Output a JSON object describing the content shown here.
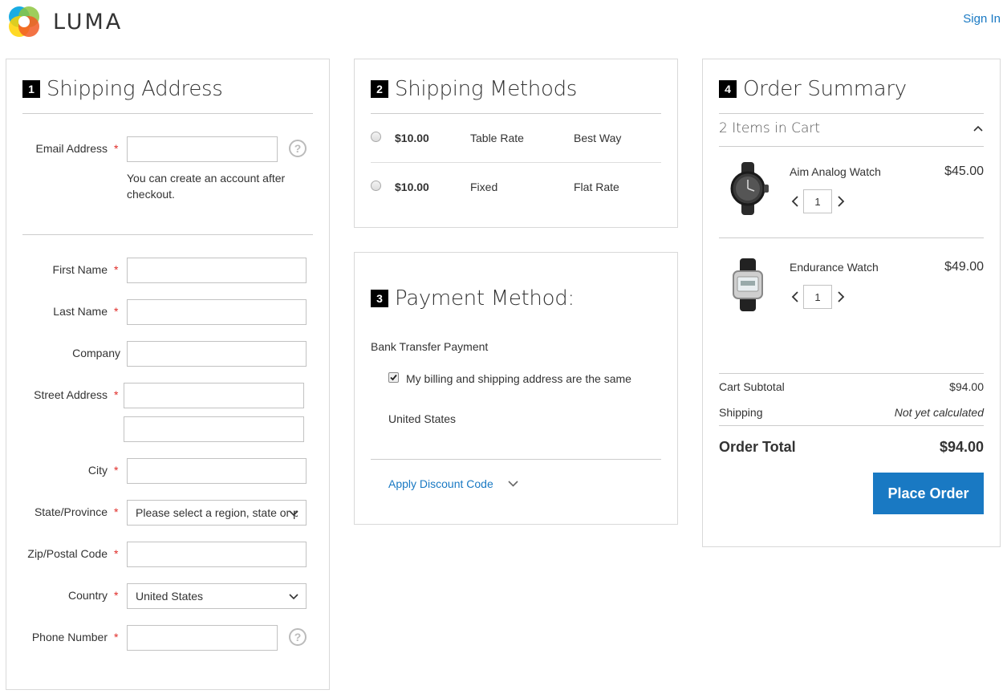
{
  "header": {
    "brand": "LUMA",
    "signin": "Sign In"
  },
  "shipping_address": {
    "step": "1",
    "title": "Shipping Address",
    "email_label": "Email Address",
    "email_note": "You can create an account after checkout.",
    "first_name_label": "First Name",
    "last_name_label": "Last Name",
    "company_label": "Company",
    "street_label": "Street Address",
    "city_label": "City",
    "state_label": "State/Province",
    "state_value": "Please select a region, state or province.",
    "zip_label": "Zip/Postal Code",
    "country_label": "Country",
    "country_value": "United States",
    "phone_label": "Phone Number",
    "required_mark": "*",
    "help_glyph": "?"
  },
  "shipping_methods": {
    "step": "2",
    "title": "Shipping Methods",
    "rows": [
      {
        "price": "$10.00",
        "method": "Table Rate",
        "carrier": "Best Way"
      },
      {
        "price": "$10.00",
        "method": "Fixed",
        "carrier": "Flat Rate"
      }
    ]
  },
  "payment": {
    "step": "3",
    "title": "Payment Method:",
    "method": "Bank Transfer Payment",
    "same_address_label": "My billing and shipping address are the same",
    "same_address_checked": true,
    "country": "United States",
    "discount_link": "Apply Discount Code"
  },
  "order_summary": {
    "step": "4",
    "title": "Order Summary",
    "items_in_cart": "2 Items in Cart",
    "items": [
      {
        "name": "Aim Analog Watch",
        "price": "$45.00",
        "qty": "1"
      },
      {
        "name": "Endurance Watch",
        "price": "$49.00",
        "qty": "1"
      }
    ],
    "subtotal_label": "Cart Subtotal",
    "subtotal_value": "$94.00",
    "shipping_label": "Shipping",
    "shipping_value": "Not yet calculated",
    "total_label": "Order Total",
    "total_value": "$94.00",
    "place_order": "Place Order"
  },
  "colors": {
    "accent": "#1979c3",
    "required": "#e02b27"
  }
}
